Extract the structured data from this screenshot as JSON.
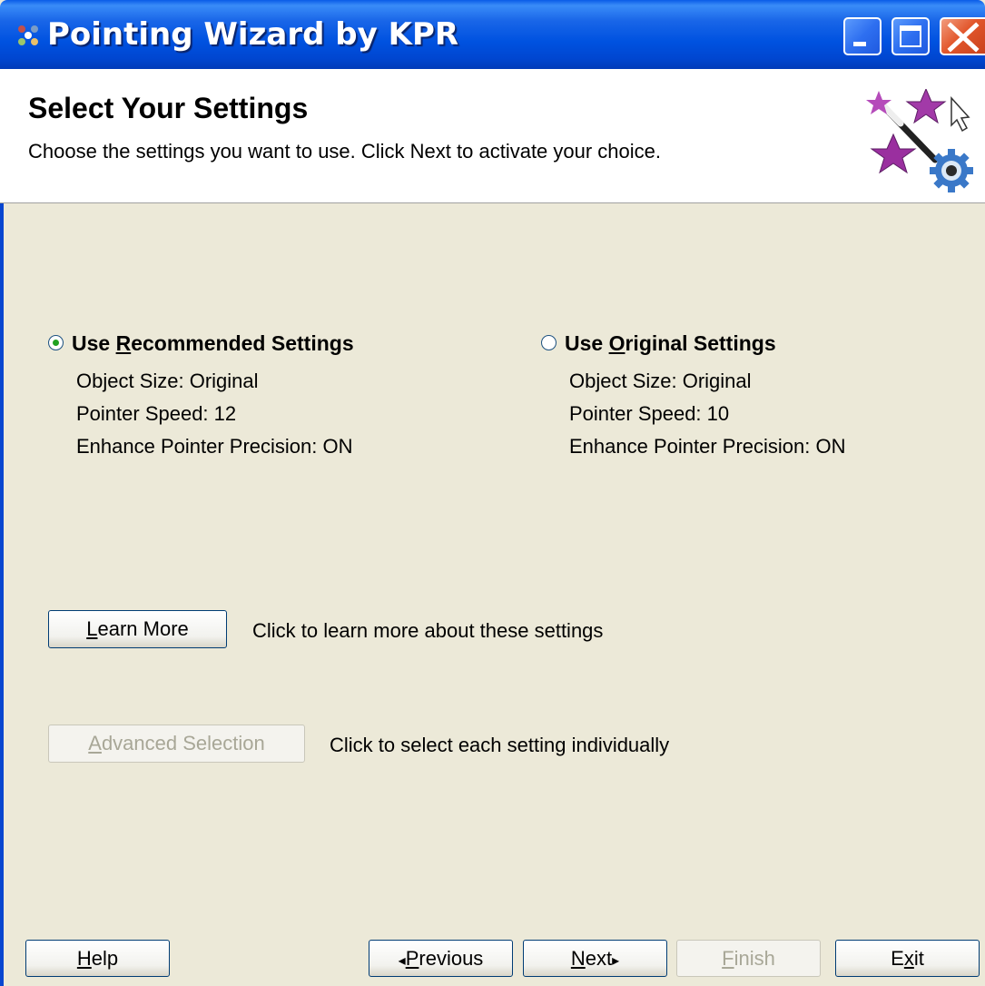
{
  "window": {
    "title": "Pointing Wizard by KPR"
  },
  "header": {
    "heading": "Select Your Settings",
    "subheading": "Choose the settings you want to use. Click Next to activate your choice."
  },
  "options": {
    "recommended": {
      "label_pre": "Use ",
      "label_accel": "R",
      "label_post": "ecommended Settings",
      "selected": true,
      "object_size": "Object Size: Original",
      "pointer_speed": "Pointer Speed: 12",
      "precision": "Enhance Pointer Precision: ON"
    },
    "original": {
      "label_pre": "Use ",
      "label_accel": "O",
      "label_post": "riginal Settings",
      "selected": false,
      "object_size": "Object Size: Original",
      "pointer_speed": "Pointer Speed: 10",
      "precision": "Enhance Pointer Precision: ON"
    }
  },
  "learn_more": {
    "accel": "L",
    "rest": "earn More",
    "hint": "Click to learn more about these settings"
  },
  "advanced": {
    "accel": "A",
    "rest": "dvanced Selection",
    "hint": "Click to select each setting individually",
    "enabled": false
  },
  "footer": {
    "help": {
      "accel": "H",
      "rest": "elp"
    },
    "previous": {
      "arrow": "◂",
      "accel": "P",
      "rest": "revious"
    },
    "next": {
      "accel": "N",
      "rest": "ext",
      "arrow": "▸"
    },
    "finish": {
      "accel": "F",
      "rest": "inish",
      "enabled": false
    },
    "exit": {
      "pre": "E",
      "accel": "x",
      "rest": "it"
    }
  },
  "colors": {
    "titlebar": "#0052e0",
    "dialog_bg": "#ece9d8",
    "radio_dot": "#21a121",
    "close_button": "#e2572c"
  },
  "icons": [
    "app-icon",
    "minimize-icon",
    "maximize-icon",
    "close-icon",
    "wizard-wand-icon",
    "radio-checked-icon",
    "radio-unchecked-icon"
  ]
}
